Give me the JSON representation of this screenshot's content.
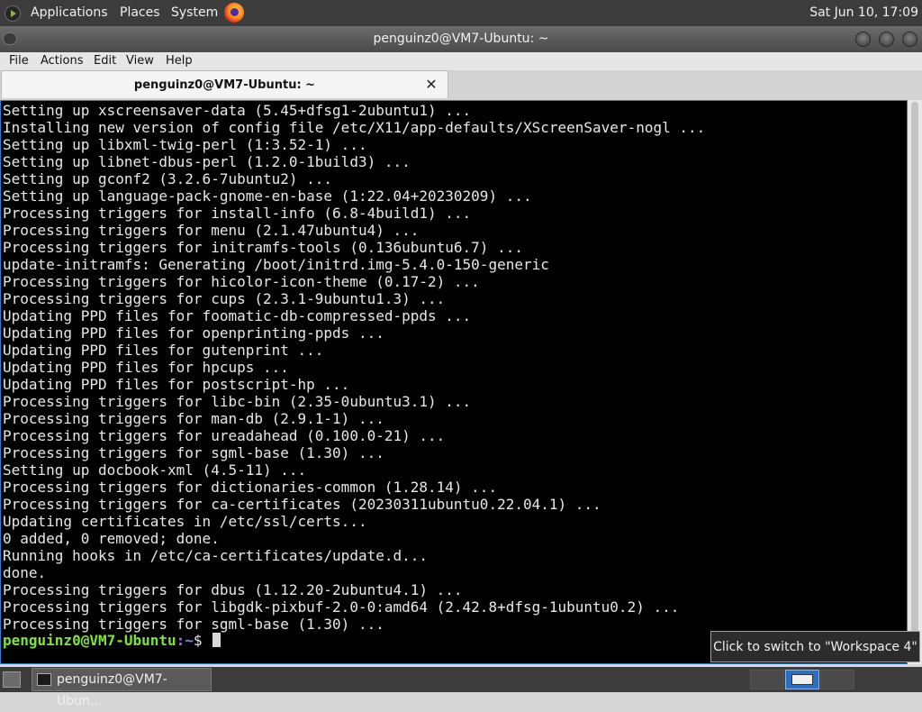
{
  "top_panel": {
    "menus": [
      "Applications",
      "Places",
      "System"
    ],
    "clock": "Sat Jun 10, 17:09",
    "launcher_icon": "firefox-icon"
  },
  "window": {
    "title": "penguinz0@VM7-Ubuntu: ~",
    "menu": [
      "File",
      "Actions",
      "Edit",
      "View",
      "Help"
    ],
    "tab_title": "penguinz0@VM7-Ubuntu: ~",
    "tab_close_icon": "close-icon"
  },
  "terminal": {
    "lines": [
      "Setting up xscreensaver-data (5.45+dfsg1-2ubuntu1) ...",
      "Installing new version of config file /etc/X11/app-defaults/XScreenSaver-nogl ...",
      "Setting up libxml-twig-perl (1:3.52-1) ...",
      "Setting up libnet-dbus-perl (1.2.0-1build3) ...",
      "Setting up gconf2 (3.2.6-7ubuntu2) ...",
      "Setting up language-pack-gnome-en-base (1:22.04+20230209) ...",
      "Processing triggers for install-info (6.8-4build1) ...",
      "Processing triggers for menu (2.1.47ubuntu4) ...",
      "Processing triggers for initramfs-tools (0.136ubuntu6.7) ...",
      "update-initramfs: Generating /boot/initrd.img-5.4.0-150-generic",
      "Processing triggers for hicolor-icon-theme (0.17-2) ...",
      "Processing triggers for cups (2.3.1-9ubuntu1.3) ...",
      "Updating PPD files for foomatic-db-compressed-ppds ...",
      "Updating PPD files for openprinting-ppds ...",
      "Updating PPD files for gutenprint ...",
      "Updating PPD files for hpcups ...",
      "Updating PPD files for postscript-hp ...",
      "Processing triggers for libc-bin (2.35-0ubuntu3.1) ...",
      "Processing triggers for man-db (2.9.1-1) ...",
      "Processing triggers for ureadahead (0.100.0-21) ...",
      "Processing triggers for sgml-base (1.30) ...",
      "Setting up docbook-xml (4.5-11) ...",
      "Processing triggers for dictionaries-common (1.28.14) ...",
      "Processing triggers for ca-certificates (20230311ubuntu0.22.04.1) ...",
      "Updating certificates in /etc/ssl/certs...",
      "0 added, 0 removed; done.",
      "Running hooks in /etc/ca-certificates/update.d...",
      "done.",
      "Processing triggers for dbus (1.12.20-2ubuntu4.1) ...",
      "Processing triggers for libgdk-pixbuf-2.0-0:amd64 (2.42.8+dfsg-1ubuntu0.2) ...",
      "Processing triggers for sgml-base (1.30) ..."
    ],
    "prompt_user": "penguinz0@VM7-Ubuntu",
    "prompt_path": ":~",
    "prompt_sign": "$"
  },
  "tooltip": "Click to switch to \"Workspace 4\"",
  "taskbar": {
    "task_label": "penguinz0@VM7-Ubun...",
    "active_workspace": 4
  },
  "colors": {
    "prompt_user": "#7ee33a",
    "prompt_path": "#6f8fe3",
    "terminal_bg": "#000000",
    "panel_bg": "#3c3c3c"
  }
}
